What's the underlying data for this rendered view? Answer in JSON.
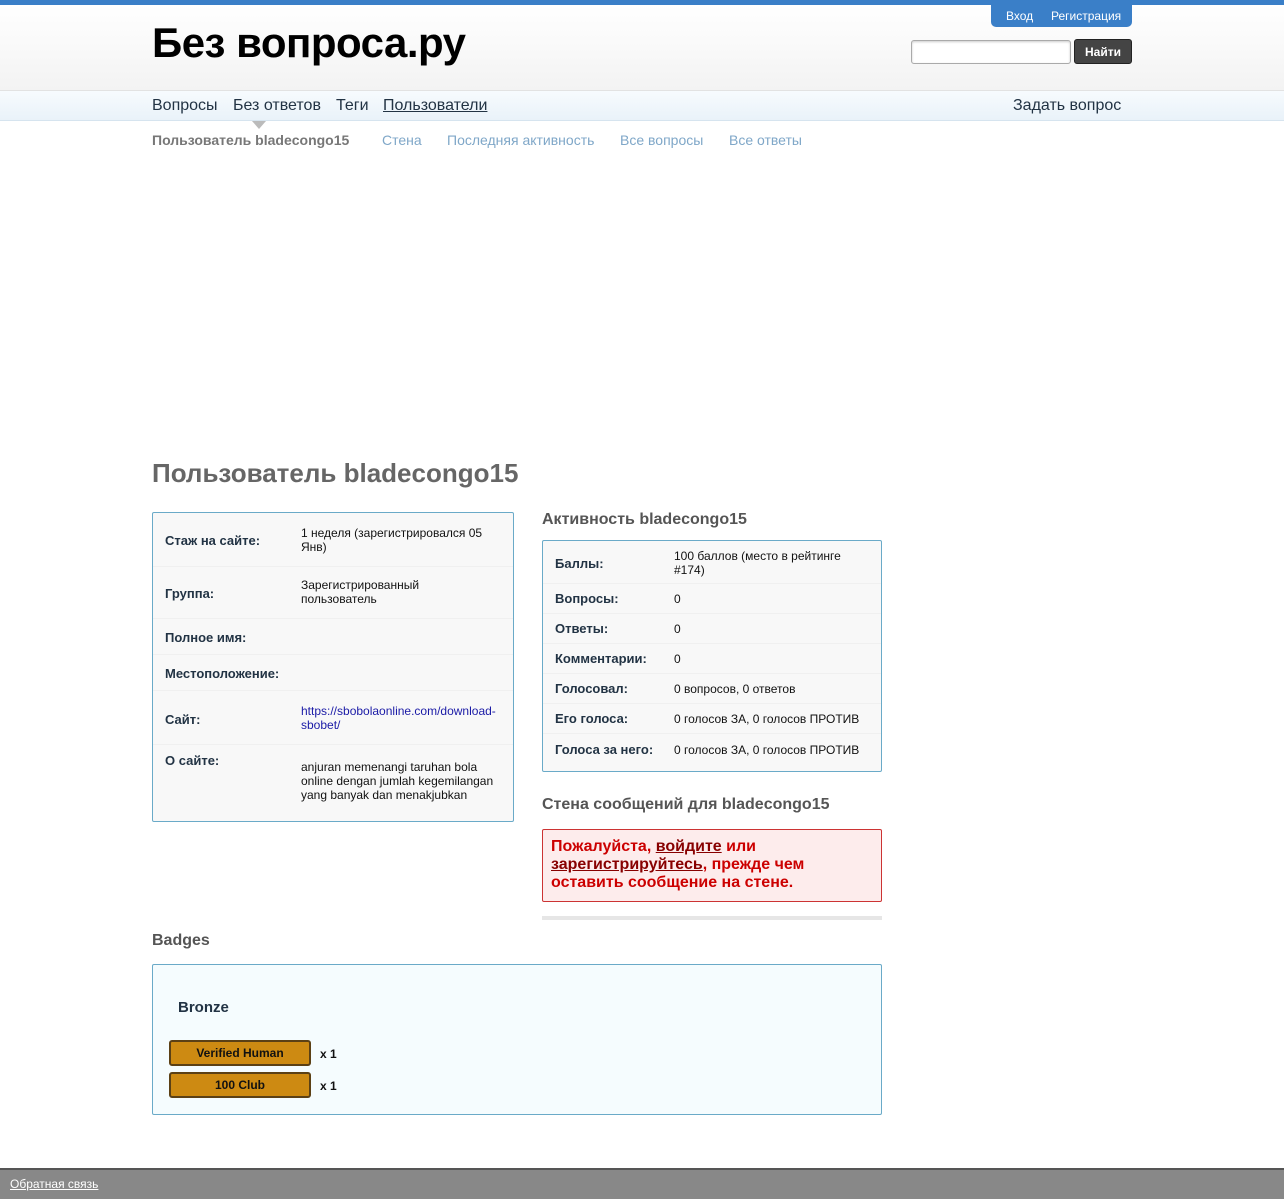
{
  "site": {
    "title": "Без вопроса.ру"
  },
  "auth": {
    "login": "Вход",
    "register": "Регистрация"
  },
  "search": {
    "placeholder": "",
    "value": "",
    "button": "Найти"
  },
  "nav": {
    "items": [
      {
        "label": "Вопросы"
      },
      {
        "label": "Без ответов"
      },
      {
        "label": "Теги"
      },
      {
        "label": "Пользователи"
      }
    ],
    "ask": "Задать вопрос"
  },
  "subnav": {
    "items": [
      {
        "label": "Пользователь bladecongo15"
      },
      {
        "label": "Стена"
      },
      {
        "label": "Последняя активность"
      },
      {
        "label": "Все вопросы"
      },
      {
        "label": "Все ответы"
      }
    ]
  },
  "profile": {
    "title": "Пользователь bladecongo15",
    "rows": [
      {
        "label": "Стаж на сайте:",
        "value": "1 неделя (зарегистрировался 05 Янв)"
      },
      {
        "label": "Группа:",
        "value": "Зарегистрированный пользователь"
      },
      {
        "label": "Полное имя:",
        "value": ""
      },
      {
        "label": "Местоположение:",
        "value": ""
      },
      {
        "label": "Сайт:",
        "value": "https://sbobolaonline.com/download-sbobet/"
      },
      {
        "label": "О сайте:",
        "value": "anjuran memenangi taruhan bola online dengan jumlah kegemilangan yang banyak dan menakjubkan"
      }
    ]
  },
  "activity": {
    "title": "Активность bladecongo15",
    "rows": [
      {
        "label": "Баллы:",
        "value": "100 баллов (место в рейтинге #174)"
      },
      {
        "label": "Вопросы:",
        "value": "0"
      },
      {
        "label": "Ответы:",
        "value": "0"
      },
      {
        "label": "Комментарии:",
        "value": "0"
      },
      {
        "label": "Голосовал:",
        "value": "0 вопросов, 0 ответов"
      },
      {
        "label": "Его голоса:",
        "value": "0 голосов ЗА, 0 голосов ПРОТИВ"
      },
      {
        "label": "Голоса за него:",
        "value": "0 голосов ЗА, 0 голосов ПРОТИВ"
      }
    ]
  },
  "wall": {
    "title": "Стена сообщений для bladecongo15",
    "msg_prefix": "Пожалуйста, ",
    "login_link": "войдите",
    "msg_middle": " или ",
    "register_link": "зарегистрируйтесь",
    "msg_suffix": ", прежде чем оставить сообщение на стене."
  },
  "badges": {
    "title": "Badges",
    "tier": "Bronze",
    "items": [
      {
        "name": "Verified Human",
        "count": "x 1"
      },
      {
        "name": "100 Club",
        "count": "x 1"
      }
    ]
  },
  "footer": {
    "feedback": "Обратная связь"
  },
  "colors": {
    "accent": "#3a7fc8",
    "badge_bronze": "#cd8a12",
    "error": "#cc0000"
  }
}
